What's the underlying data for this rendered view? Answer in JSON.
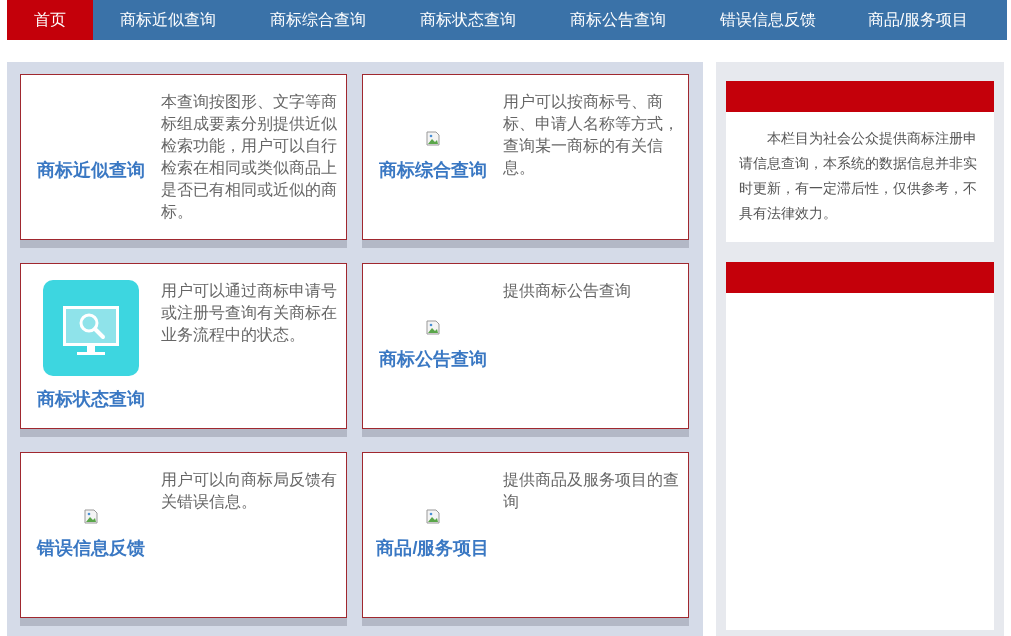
{
  "nav": {
    "tabs": [
      {
        "label": "首页",
        "selected": true
      },
      {
        "label": "商标近似查询",
        "selected": false
      },
      {
        "label": "商标综合查询",
        "selected": false
      },
      {
        "label": "商标状态查询",
        "selected": false
      },
      {
        "label": "商标公告查询",
        "selected": false
      },
      {
        "label": "错误信息反馈",
        "selected": false
      },
      {
        "label": "商品/服务项目",
        "selected": false
      }
    ]
  },
  "cards": [
    {
      "title": "商标近似查询",
      "kind": "none",
      "description": "本查询按图形、文字等商标组成要素分别提供近似检索功能，用户可以自行检索在相同或类似商品上是否已有相同或近似的商标。"
    },
    {
      "title": "商标综合查询",
      "kind": "broken",
      "description": "用户可以按商标号、商标、申请人名称等方式，查询某一商标的有关信息。"
    },
    {
      "title": "商标状态查询",
      "kind": "monitor",
      "description": "用户可以通过商标申请号或注册号查询有关商标在业务流程中的状态。"
    },
    {
      "title": "商标公告查询",
      "kind": "broken",
      "description": "提供商标公告查询"
    },
    {
      "title": "错误信息反馈",
      "kind": "broken",
      "description": "用户可以向商标局反馈有关错误信息。"
    },
    {
      "title": "商品/服务项目",
      "kind": "broken",
      "description": "提供商品及服务项目的查询"
    }
  ],
  "sidebar": {
    "panels": [
      {
        "kind": "notice",
        "text": "本栏目为社会公众提供商标注册申请信息查询，本系统的数据信息并非实时更新，有一定滞后性，仅供参考，不具有法律效力。"
      },
      {
        "kind": "empty"
      }
    ]
  }
}
